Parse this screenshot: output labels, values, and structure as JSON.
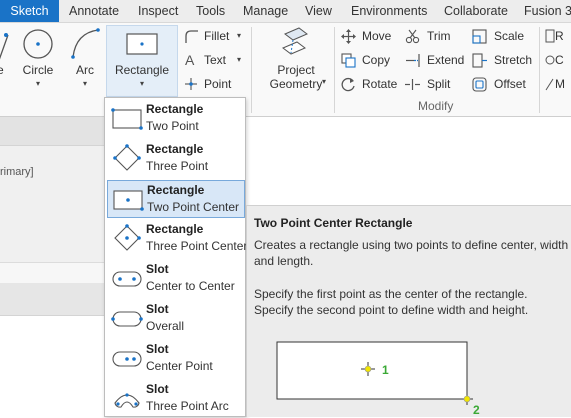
{
  "tabs": [
    {
      "label": "Sketch",
      "active": true
    },
    {
      "label": "Annotate"
    },
    {
      "label": "Inspect"
    },
    {
      "label": "Tools"
    },
    {
      "label": "Manage"
    },
    {
      "label": "View"
    },
    {
      "label": "Environments"
    },
    {
      "label": "Collaborate"
    },
    {
      "label": "Fusion 36"
    }
  ],
  "ribbon": {
    "circle_label": "Circle",
    "arc_label": "Arc",
    "rectangle_label": "Rectangle",
    "fillet_label": "Fillet",
    "text_label": "Text",
    "point_label": "Point",
    "project_geometry_line1": "Project",
    "project_geometry_line2": "Geometry",
    "move_label": "Move",
    "copy_label": "Copy",
    "rotate_label": "Rotate",
    "trim_label": "Trim",
    "extend_label": "Extend",
    "split_label": "Split",
    "scale_label": "Scale",
    "stretch_label": "Stretch",
    "offset_label": "Offset",
    "modify_group_label": "Modify",
    "clipped_labels": [
      "R",
      "C",
      "M"
    ]
  },
  "left_panel": {
    "clipped_text": "rimary]"
  },
  "dropdown": {
    "items": [
      {
        "title": "Rectangle",
        "subtitle": "Two Point",
        "icon": "rectangle-two-point-icon"
      },
      {
        "title": "Rectangle",
        "subtitle": "Three Point",
        "icon": "rectangle-three-point-icon"
      },
      {
        "title": "Rectangle",
        "subtitle": "Two Point Center",
        "icon": "rectangle-two-point-center-icon",
        "selected": true
      },
      {
        "title": "Rectangle",
        "subtitle": "Three Point Center",
        "icon": "rectangle-three-point-center-icon"
      },
      {
        "title": "Slot",
        "subtitle": "Center to Center",
        "icon": "slot-center-to-center-icon"
      },
      {
        "title": "Slot",
        "subtitle": "Overall",
        "icon": "slot-overall-icon"
      },
      {
        "title": "Slot",
        "subtitle": "Center Point",
        "icon": "slot-center-point-icon"
      },
      {
        "title": "Slot",
        "subtitle": "Three Point Arc",
        "icon": "slot-three-point-arc-icon"
      }
    ]
  },
  "tooltip": {
    "title": "Two Point Center Rectangle",
    "description": "Creates a rectangle using two points to define center, width and length.",
    "hint": "Specify the first point as the center of the rectangle. Specify the second point to define width and height.",
    "point1": "1",
    "point2": "2"
  },
  "colors": {
    "accent": "#1a73c7",
    "selection_bg": "#d8e7f7",
    "point_marker": "#f2e600",
    "point_label": "#3aa935"
  }
}
